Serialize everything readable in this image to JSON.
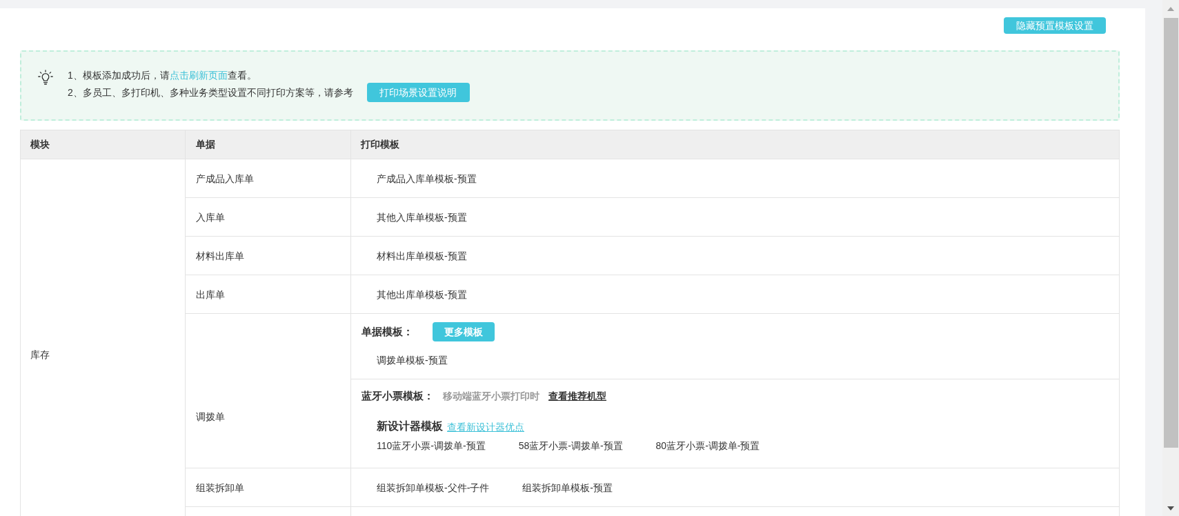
{
  "top_button": {
    "label": "隐藏预置模板设置"
  },
  "tip": {
    "lines": [
      {
        "kind": "link",
        "before": "1、模板添加成功后，请",
        "link": "点击刷新页面",
        "after": "查看。"
      },
      {
        "kind": "button",
        "text": "2、多员工、多打印机、多种业务类型设置不同打印方案等，请参考",
        "button": "打印场景设置说明"
      }
    ]
  },
  "table": {
    "columns": [
      "模块",
      "单据",
      "打印模板"
    ],
    "groups": [
      {
        "module": "库存",
        "rows": [
          {
            "kind": "simple",
            "document": "产成品入库单",
            "templates": [
              "产成品入库单模板-预置"
            ]
          },
          {
            "kind": "simple",
            "document": "入库单",
            "templates": [
              "其他入库单模板-预置"
            ]
          },
          {
            "kind": "simple",
            "document": "材料出库单",
            "templates": [
              "材料出库单模板-预置"
            ]
          },
          {
            "kind": "simple",
            "document": "出库单",
            "templates": [
              "其他出库单模板-预置"
            ]
          },
          {
            "kind": "sectioned",
            "document": "调拨单",
            "sections": [
              {
                "kind": "document",
                "title": "单据模板：",
                "button": "更多模板",
                "templates": [
                  "调拨单模板-预置"
                ]
              },
              {
                "kind": "bluetooth",
                "title": "蓝牙小票模板：",
                "note": "移动端蓝牙小票打印时",
                "link": "查看推荐机型",
                "designer": {
                  "title": "新设计器模板",
                  "link": "查看新设计器优点",
                  "templates": [
                    "110蓝牙小票-调拨单-预置",
                    "58蓝牙小票-调拨单-预置",
                    "80蓝牙小票-调拨单-预置"
                  ]
                }
              }
            ]
          },
          {
            "kind": "simple",
            "document": "组装拆卸单",
            "templates": [
              "组装拆卸单模板-父件-子件",
              "组装拆卸单模板-预置"
            ]
          }
        ]
      }
    ]
  }
}
